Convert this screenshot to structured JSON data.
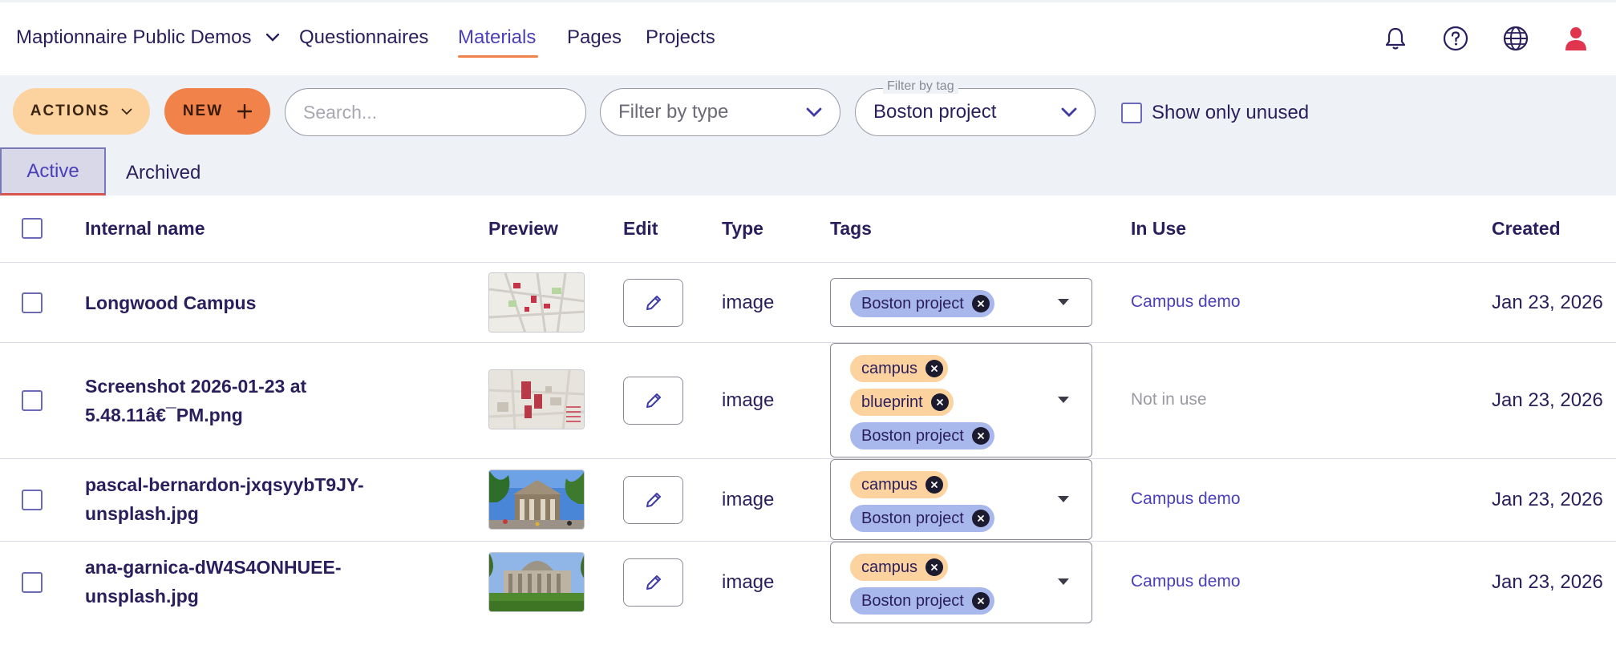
{
  "nav": {
    "org_name": "Maptionnaire Public Demos",
    "links": [
      "Questionnaires",
      "Materials",
      "Pages",
      "Projects"
    ],
    "active_link": "Materials"
  },
  "toolbar": {
    "actions_label": "ACTIONS",
    "new_label": "NEW",
    "search_placeholder": "Search...",
    "filter_type_value": "Filter by type",
    "filter_tag_label": "Filter by tag",
    "filter_tag_value": "Boston project",
    "show_unused_label": "Show only unused"
  },
  "tabs": {
    "active": "Active",
    "archived": "Archived"
  },
  "table": {
    "headers": {
      "name": "Internal name",
      "preview": "Preview",
      "edit": "Edit",
      "type": "Type",
      "tags": "Tags",
      "in_use": "In Use",
      "created": "Created"
    },
    "rows": [
      {
        "name": "Longwood Campus",
        "type": "image",
        "tags": [
          "Boston project"
        ],
        "in_use": "Campus demo",
        "created": "Jan 23, 2026"
      },
      {
        "name": "Screenshot 2026-01-23 at 5.48.11â€¯PM.png",
        "type": "image",
        "tags": [
          "campus",
          "blueprint",
          "Boston project"
        ],
        "in_use": "Not in use",
        "created": "Jan 23, 2026"
      },
      {
        "name": "pascal-bernardon-jxqsyybT9JY-unsplash.jpg",
        "type": "image",
        "tags": [
          "campus",
          "Boston project"
        ],
        "in_use": "Campus demo",
        "created": "Jan 23, 2026"
      },
      {
        "name": "ana-garnica-dW4S4ONHUEE-unsplash.jpg",
        "type": "image",
        "tags": [
          "campus",
          "Boston project"
        ],
        "in_use": "Campus demo",
        "created": "Jan 23, 2026"
      }
    ]
  },
  "colors": {
    "accent": "#4a3fb8",
    "actions_button": "#fcd29f",
    "new_button": "#f0824a",
    "chip_blue": "#a8b8ec",
    "chip_peach": "#fcd29f",
    "avatar": "#e0354f"
  },
  "icons": [
    "chevron-down-icon",
    "bell-icon",
    "help-icon",
    "globe-icon",
    "user-icon",
    "plus-icon",
    "pencil-icon",
    "close-icon"
  ]
}
